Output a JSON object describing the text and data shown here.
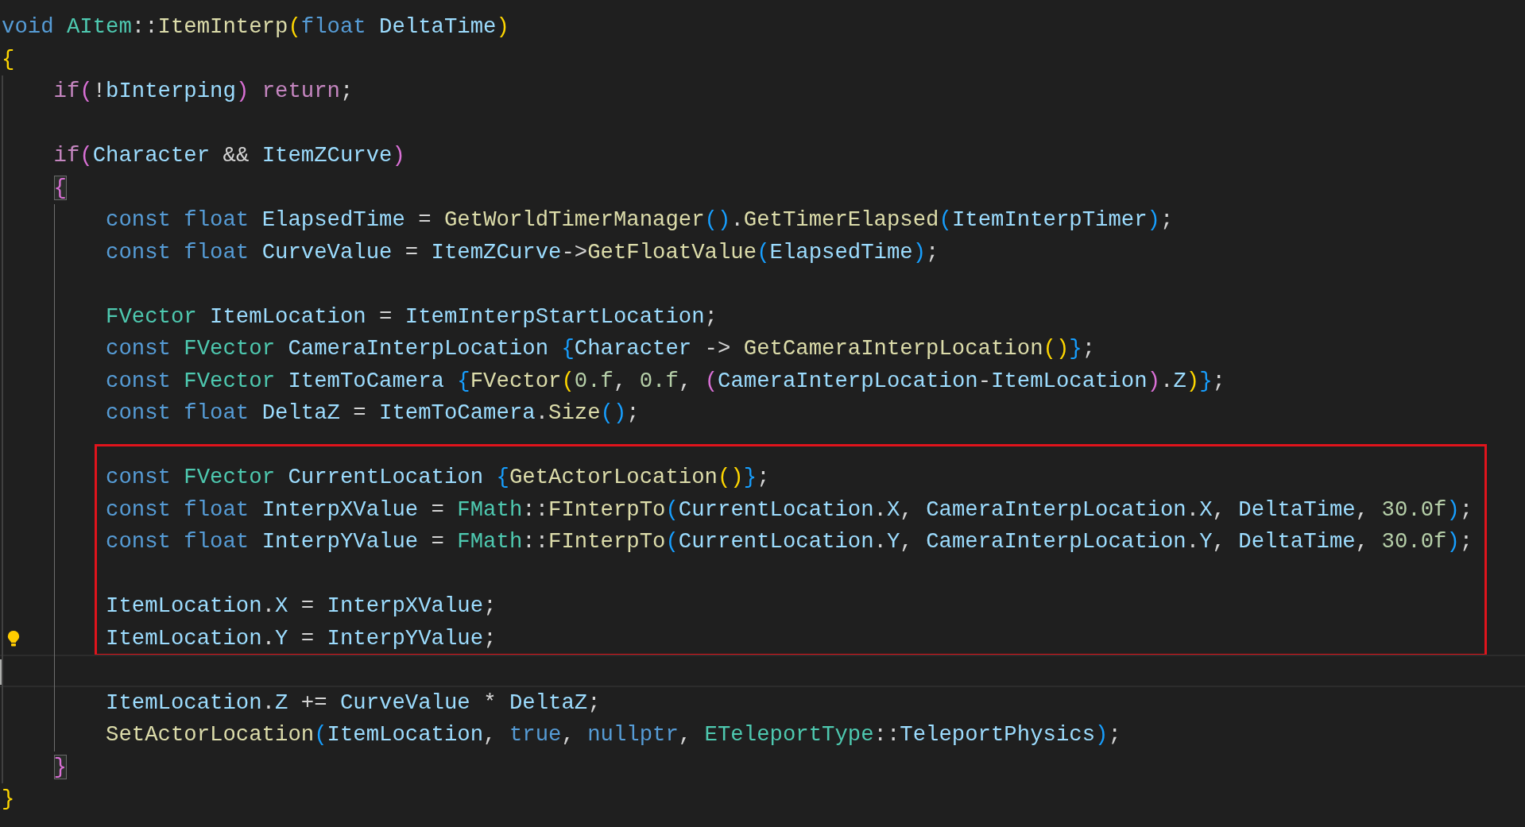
{
  "editor": {
    "sections": [
      {
        "kind": "plain",
        "lines": [
          {
            "kind": "code",
            "tokens": [
              {
                "kind": "kw",
                "text": "void "
              },
              {
                "kind": "type",
                "text": "AItem"
              },
              {
                "kind": "op",
                "text": "::"
              },
              {
                "kind": "fn",
                "text": "ItemInterp"
              },
              {
                "kind": "b1",
                "text": "("
              },
              {
                "kind": "kw",
                "text": "float "
              },
              {
                "kind": "var",
                "text": "DeltaTime"
              },
              {
                "kind": "b1",
                "text": ")"
              }
            ]
          },
          {
            "kind": "code",
            "tokens": [
              {
                "kind": "b1",
                "text": "{"
              }
            ]
          },
          {
            "kind": "code",
            "tokens": [
              {
                "kind": "ctrl",
                "text": "    if"
              },
              {
                "kind": "b2",
                "text": "("
              },
              {
                "kind": "op",
                "text": "!"
              },
              {
                "kind": "var",
                "text": "bInterping"
              },
              {
                "kind": "b2",
                "text": ")"
              },
              {
                "kind": "ctrl",
                "text": " return"
              },
              {
                "kind": "op",
                "text": ";"
              }
            ]
          },
          {
            "kind": "blank"
          },
          {
            "kind": "code",
            "tokens": [
              {
                "kind": "ctrl",
                "text": "    if"
              },
              {
                "kind": "b2",
                "text": "("
              },
              {
                "kind": "var",
                "text": "Character"
              },
              {
                "kind": "op",
                "text": " && "
              },
              {
                "kind": "var",
                "text": "ItemZCurve"
              },
              {
                "kind": "b2",
                "text": ")"
              }
            ]
          },
          {
            "kind": "code",
            "tokens": [
              {
                "kind": "b2m",
                "text": "    {"
              }
            ]
          },
          {
            "kind": "code",
            "tokens": [
              {
                "kind": "kw",
                "text": "        const float "
              },
              {
                "kind": "var",
                "text": "ElapsedTime"
              },
              {
                "kind": "op",
                "text": " = "
              },
              {
                "kind": "fn",
                "text": "GetWorldTimerManager"
              },
              {
                "kind": "b3",
                "text": "()"
              },
              {
                "kind": "op",
                "text": "."
              },
              {
                "kind": "fn",
                "text": "GetTimerElapsed"
              },
              {
                "kind": "b3",
                "text": "("
              },
              {
                "kind": "var",
                "text": "ItemInterpTimer"
              },
              {
                "kind": "b3",
                "text": ")"
              },
              {
                "kind": "op",
                "text": ";"
              }
            ]
          },
          {
            "kind": "code",
            "tokens": [
              {
                "kind": "kw",
                "text": "        const float "
              },
              {
                "kind": "var",
                "text": "CurveValue"
              },
              {
                "kind": "op",
                "text": " = "
              },
              {
                "kind": "var",
                "text": "ItemZCurve"
              },
              {
                "kind": "op",
                "text": "->"
              },
              {
                "kind": "fn",
                "text": "GetFloatValue"
              },
              {
                "kind": "b3",
                "text": "("
              },
              {
                "kind": "var",
                "text": "ElapsedTime"
              },
              {
                "kind": "b3",
                "text": ")"
              },
              {
                "kind": "op",
                "text": ";"
              }
            ]
          },
          {
            "kind": "blank"
          },
          {
            "kind": "code",
            "tokens": [
              {
                "kind": "type",
                "text": "        FVector "
              },
              {
                "kind": "var",
                "text": "ItemLocation"
              },
              {
                "kind": "op",
                "text": " = "
              },
              {
                "kind": "var",
                "text": "ItemInterpStartLocation"
              },
              {
                "kind": "op",
                "text": ";"
              }
            ]
          },
          {
            "kind": "code",
            "tokens": [
              {
                "kind": "kw",
                "text": "        const "
              },
              {
                "kind": "type",
                "text": "FVector "
              },
              {
                "kind": "var",
                "text": "CameraInterpLocation "
              },
              {
                "kind": "b3",
                "text": "{"
              },
              {
                "kind": "var",
                "text": "Character "
              },
              {
                "kind": "op",
                "text": "-> "
              },
              {
                "kind": "fn",
                "text": "GetCameraInterpLocation"
              },
              {
                "kind": "b1",
                "text": "()"
              },
              {
                "kind": "b3",
                "text": "}"
              },
              {
                "kind": "op",
                "text": ";"
              }
            ]
          },
          {
            "kind": "code",
            "tokens": [
              {
                "kind": "kw",
                "text": "        const "
              },
              {
                "kind": "type",
                "text": "FVector "
              },
              {
                "kind": "var",
                "text": "ItemToCamera "
              },
              {
                "kind": "b3",
                "text": "{"
              },
              {
                "kind": "fn",
                "text": "FVector"
              },
              {
                "kind": "b1",
                "text": "("
              },
              {
                "kind": "num",
                "text": "0.f"
              },
              {
                "kind": "op",
                "text": ", "
              },
              {
                "kind": "num",
                "text": "0.f"
              },
              {
                "kind": "op",
                "text": ", "
              },
              {
                "kind": "b2",
                "text": "("
              },
              {
                "kind": "var",
                "text": "CameraInterpLocation"
              },
              {
                "kind": "op",
                "text": "-"
              },
              {
                "kind": "var",
                "text": "ItemLocation"
              },
              {
                "kind": "b2",
                "text": ")"
              },
              {
                "kind": "op",
                "text": "."
              },
              {
                "kind": "var",
                "text": "Z"
              },
              {
                "kind": "b1",
                "text": ")"
              },
              {
                "kind": "b3",
                "text": "}"
              },
              {
                "kind": "op",
                "text": ";"
              }
            ]
          },
          {
            "kind": "code",
            "tokens": [
              {
                "kind": "kw",
                "text": "        const float "
              },
              {
                "kind": "var",
                "text": "DeltaZ"
              },
              {
                "kind": "op",
                "text": " = "
              },
              {
                "kind": "var",
                "text": "ItemToCamera"
              },
              {
                "kind": "op",
                "text": "."
              },
              {
                "kind": "fn",
                "text": "Size"
              },
              {
                "kind": "b3",
                "text": "()"
              },
              {
                "kind": "op",
                "text": ";"
              }
            ]
          }
        ]
      },
      {
        "kind": "highlighted",
        "lines": [
          {
            "kind": "blank"
          },
          {
            "kind": "code",
            "tokens": [
              {
                "kind": "kw",
                "text": "        const "
              },
              {
                "kind": "type",
                "text": "FVector "
              },
              {
                "kind": "var",
                "text": "CurrentLocation "
              },
              {
                "kind": "b3",
                "text": "{"
              },
              {
                "kind": "fn",
                "text": "GetActorLocation"
              },
              {
                "kind": "b1",
                "text": "()"
              },
              {
                "kind": "b3",
                "text": "}"
              },
              {
                "kind": "op",
                "text": ";"
              }
            ]
          },
          {
            "kind": "code",
            "tokens": [
              {
                "kind": "kw",
                "text": "        const float "
              },
              {
                "kind": "var",
                "text": "InterpXValue"
              },
              {
                "kind": "op",
                "text": " = "
              },
              {
                "kind": "type",
                "text": "FMath"
              },
              {
                "kind": "op",
                "text": "::"
              },
              {
                "kind": "fn",
                "text": "FInterpTo"
              },
              {
                "kind": "b3",
                "text": "("
              },
              {
                "kind": "var",
                "text": "CurrentLocation"
              },
              {
                "kind": "op",
                "text": "."
              },
              {
                "kind": "var",
                "text": "X"
              },
              {
                "kind": "op",
                "text": ", "
              },
              {
                "kind": "var",
                "text": "CameraInterpLocation"
              },
              {
                "kind": "op",
                "text": "."
              },
              {
                "kind": "var",
                "text": "X"
              },
              {
                "kind": "op",
                "text": ", "
              },
              {
                "kind": "var",
                "text": "DeltaTime"
              },
              {
                "kind": "op",
                "text": ", "
              },
              {
                "kind": "num",
                "text": "30.0f"
              },
              {
                "kind": "b3",
                "text": ")"
              },
              {
                "kind": "op",
                "text": ";"
              }
            ]
          },
          {
            "kind": "code",
            "tokens": [
              {
                "kind": "kw",
                "text": "        const float "
              },
              {
                "kind": "var",
                "text": "InterpYValue"
              },
              {
                "kind": "op",
                "text": " = "
              },
              {
                "kind": "type",
                "text": "FMath"
              },
              {
                "kind": "op",
                "text": "::"
              },
              {
                "kind": "fn",
                "text": "FInterpTo"
              },
              {
                "kind": "b3",
                "text": "("
              },
              {
                "kind": "var",
                "text": "CurrentLocation"
              },
              {
                "kind": "op",
                "text": "."
              },
              {
                "kind": "var",
                "text": "Y"
              },
              {
                "kind": "op",
                "text": ", "
              },
              {
                "kind": "var",
                "text": "CameraInterpLocation"
              },
              {
                "kind": "op",
                "text": "."
              },
              {
                "kind": "var",
                "text": "Y"
              },
              {
                "kind": "op",
                "text": ", "
              },
              {
                "kind": "var",
                "text": "DeltaTime"
              },
              {
                "kind": "op",
                "text": ", "
              },
              {
                "kind": "num",
                "text": "30.0f"
              },
              {
                "kind": "b3",
                "text": ")"
              },
              {
                "kind": "op",
                "text": ";"
              }
            ]
          },
          {
            "kind": "blank"
          },
          {
            "kind": "code",
            "tokens": [
              {
                "kind": "var",
                "text": "        ItemLocation"
              },
              {
                "kind": "op",
                "text": "."
              },
              {
                "kind": "var",
                "text": "X"
              },
              {
                "kind": "op",
                "text": " = "
              },
              {
                "kind": "var",
                "text": "InterpXValue"
              },
              {
                "kind": "op",
                "text": ";"
              }
            ]
          },
          {
            "kind": "code-lightbulb",
            "tokens": [
              {
                "kind": "var",
                "text": "        ItemLocation"
              },
              {
                "kind": "op",
                "text": "."
              },
              {
                "kind": "var",
                "text": "Y"
              },
              {
                "kind": "op",
                "text": " = "
              },
              {
                "kind": "var",
                "text": "InterpYValue"
              },
              {
                "kind": "op",
                "text": ";"
              }
            ]
          }
        ]
      },
      {
        "kind": "plain",
        "lines": [
          {
            "kind": "cursor"
          },
          {
            "kind": "code",
            "tokens": [
              {
                "kind": "var",
                "text": "        ItemLocation"
              },
              {
                "kind": "op",
                "text": "."
              },
              {
                "kind": "var",
                "text": "Z"
              },
              {
                "kind": "op",
                "text": " += "
              },
              {
                "kind": "var",
                "text": "CurveValue"
              },
              {
                "kind": "op",
                "text": " * "
              },
              {
                "kind": "var",
                "text": "DeltaZ"
              },
              {
                "kind": "op",
                "text": ";"
              }
            ]
          },
          {
            "kind": "code",
            "tokens": [
              {
                "kind": "fn",
                "text": "        SetActorLocation"
              },
              {
                "kind": "b3",
                "text": "("
              },
              {
                "kind": "var",
                "text": "ItemLocation"
              },
              {
                "kind": "op",
                "text": ", "
              },
              {
                "kind": "kw",
                "text": "true"
              },
              {
                "kind": "op",
                "text": ", "
              },
              {
                "kind": "kw",
                "text": "nullptr"
              },
              {
                "kind": "op",
                "text": ", "
              },
              {
                "kind": "type",
                "text": "ETeleportType"
              },
              {
                "kind": "op",
                "text": "::"
              },
              {
                "kind": "var",
                "text": "TeleportPhysics"
              },
              {
                "kind": "b3",
                "text": ")"
              },
              {
                "kind": "op",
                "text": ";"
              }
            ]
          },
          {
            "kind": "code",
            "tokens": [
              {
                "kind": "b2m",
                "text": "    }"
              }
            ]
          },
          {
            "kind": "code",
            "tokens": [
              {
                "kind": "b1",
                "text": "}"
              }
            ]
          }
        ]
      }
    ]
  }
}
